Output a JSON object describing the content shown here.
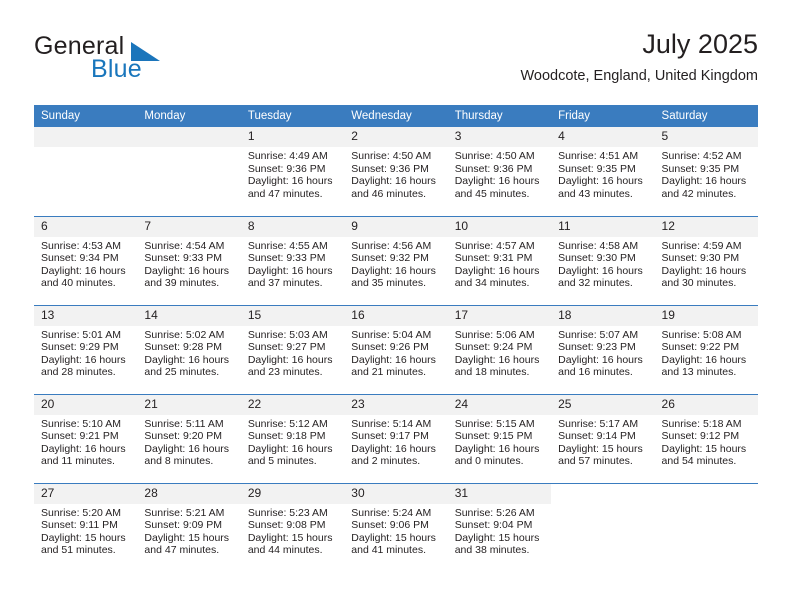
{
  "brand": {
    "word_one": "General",
    "word_two": "Blue",
    "accent_color": "#1b75bb",
    "logo_icon": "triangle-icon"
  },
  "header": {
    "title": "July 2025",
    "location": "Woodcote, England, United Kingdom"
  },
  "calendar": {
    "header_bg": "#3a7cbf",
    "daynum_bg": "#f2f2f2",
    "weekday_headers": [
      "Sunday",
      "Monday",
      "Tuesday",
      "Wednesday",
      "Thursday",
      "Friday",
      "Saturday"
    ],
    "weeks": [
      [
        {
          "day": "",
          "lines": []
        },
        {
          "day": "",
          "lines": []
        },
        {
          "day": "1",
          "lines": [
            "Sunrise: 4:49 AM",
            "Sunset: 9:36 PM",
            "Daylight: 16 hours",
            "and 47 minutes."
          ]
        },
        {
          "day": "2",
          "lines": [
            "Sunrise: 4:50 AM",
            "Sunset: 9:36 PM",
            "Daylight: 16 hours",
            "and 46 minutes."
          ]
        },
        {
          "day": "3",
          "lines": [
            "Sunrise: 4:50 AM",
            "Sunset: 9:36 PM",
            "Daylight: 16 hours",
            "and 45 minutes."
          ]
        },
        {
          "day": "4",
          "lines": [
            "Sunrise: 4:51 AM",
            "Sunset: 9:35 PM",
            "Daylight: 16 hours",
            "and 43 minutes."
          ]
        },
        {
          "day": "5",
          "lines": [
            "Sunrise: 4:52 AM",
            "Sunset: 9:35 PM",
            "Daylight: 16 hours",
            "and 42 minutes."
          ]
        }
      ],
      [
        {
          "day": "6",
          "lines": [
            "Sunrise: 4:53 AM",
            "Sunset: 9:34 PM",
            "Daylight: 16 hours",
            "and 40 minutes."
          ]
        },
        {
          "day": "7",
          "lines": [
            "Sunrise: 4:54 AM",
            "Sunset: 9:33 PM",
            "Daylight: 16 hours",
            "and 39 minutes."
          ]
        },
        {
          "day": "8",
          "lines": [
            "Sunrise: 4:55 AM",
            "Sunset: 9:33 PM",
            "Daylight: 16 hours",
            "and 37 minutes."
          ]
        },
        {
          "day": "9",
          "lines": [
            "Sunrise: 4:56 AM",
            "Sunset: 9:32 PM",
            "Daylight: 16 hours",
            "and 35 minutes."
          ]
        },
        {
          "day": "10",
          "lines": [
            "Sunrise: 4:57 AM",
            "Sunset: 9:31 PM",
            "Daylight: 16 hours",
            "and 34 minutes."
          ]
        },
        {
          "day": "11",
          "lines": [
            "Sunrise: 4:58 AM",
            "Sunset: 9:30 PM",
            "Daylight: 16 hours",
            "and 32 minutes."
          ]
        },
        {
          "day": "12",
          "lines": [
            "Sunrise: 4:59 AM",
            "Sunset: 9:30 PM",
            "Daylight: 16 hours",
            "and 30 minutes."
          ]
        }
      ],
      [
        {
          "day": "13",
          "lines": [
            "Sunrise: 5:01 AM",
            "Sunset: 9:29 PM",
            "Daylight: 16 hours",
            "and 28 minutes."
          ]
        },
        {
          "day": "14",
          "lines": [
            "Sunrise: 5:02 AM",
            "Sunset: 9:28 PM",
            "Daylight: 16 hours",
            "and 25 minutes."
          ]
        },
        {
          "day": "15",
          "lines": [
            "Sunrise: 5:03 AM",
            "Sunset: 9:27 PM",
            "Daylight: 16 hours",
            "and 23 minutes."
          ]
        },
        {
          "day": "16",
          "lines": [
            "Sunrise: 5:04 AM",
            "Sunset: 9:26 PM",
            "Daylight: 16 hours",
            "and 21 minutes."
          ]
        },
        {
          "day": "17",
          "lines": [
            "Sunrise: 5:06 AM",
            "Sunset: 9:24 PM",
            "Daylight: 16 hours",
            "and 18 minutes."
          ]
        },
        {
          "day": "18",
          "lines": [
            "Sunrise: 5:07 AM",
            "Sunset: 9:23 PM",
            "Daylight: 16 hours",
            "and 16 minutes."
          ]
        },
        {
          "day": "19",
          "lines": [
            "Sunrise: 5:08 AM",
            "Sunset: 9:22 PM",
            "Daylight: 16 hours",
            "and 13 minutes."
          ]
        }
      ],
      [
        {
          "day": "20",
          "lines": [
            "Sunrise: 5:10 AM",
            "Sunset: 9:21 PM",
            "Daylight: 16 hours",
            "and 11 minutes."
          ]
        },
        {
          "day": "21",
          "lines": [
            "Sunrise: 5:11 AM",
            "Sunset: 9:20 PM",
            "Daylight: 16 hours",
            "and 8 minutes."
          ]
        },
        {
          "day": "22",
          "lines": [
            "Sunrise: 5:12 AM",
            "Sunset: 9:18 PM",
            "Daylight: 16 hours",
            "and 5 minutes."
          ]
        },
        {
          "day": "23",
          "lines": [
            "Sunrise: 5:14 AM",
            "Sunset: 9:17 PM",
            "Daylight: 16 hours",
            "and 2 minutes."
          ]
        },
        {
          "day": "24",
          "lines": [
            "Sunrise: 5:15 AM",
            "Sunset: 9:15 PM",
            "Daylight: 16 hours",
            "and 0 minutes."
          ]
        },
        {
          "day": "25",
          "lines": [
            "Sunrise: 5:17 AM",
            "Sunset: 9:14 PM",
            "Daylight: 15 hours",
            "and 57 minutes."
          ]
        },
        {
          "day": "26",
          "lines": [
            "Sunrise: 5:18 AM",
            "Sunset: 9:12 PM",
            "Daylight: 15 hours",
            "and 54 minutes."
          ]
        }
      ],
      [
        {
          "day": "27",
          "lines": [
            "Sunrise: 5:20 AM",
            "Sunset: 9:11 PM",
            "Daylight: 15 hours",
            "and 51 minutes."
          ]
        },
        {
          "day": "28",
          "lines": [
            "Sunrise: 5:21 AM",
            "Sunset: 9:09 PM",
            "Daylight: 15 hours",
            "and 47 minutes."
          ]
        },
        {
          "day": "29",
          "lines": [
            "Sunrise: 5:23 AM",
            "Sunset: 9:08 PM",
            "Daylight: 15 hours",
            "and 44 minutes."
          ]
        },
        {
          "day": "30",
          "lines": [
            "Sunrise: 5:24 AM",
            "Sunset: 9:06 PM",
            "Daylight: 15 hours",
            "and 41 minutes."
          ]
        },
        {
          "day": "31",
          "lines": [
            "Sunrise: 5:26 AM",
            "Sunset: 9:04 PM",
            "Daylight: 15 hours",
            "and 38 minutes."
          ]
        },
        {
          "day": "",
          "lines": []
        },
        {
          "day": "",
          "lines": []
        }
      ]
    ]
  }
}
